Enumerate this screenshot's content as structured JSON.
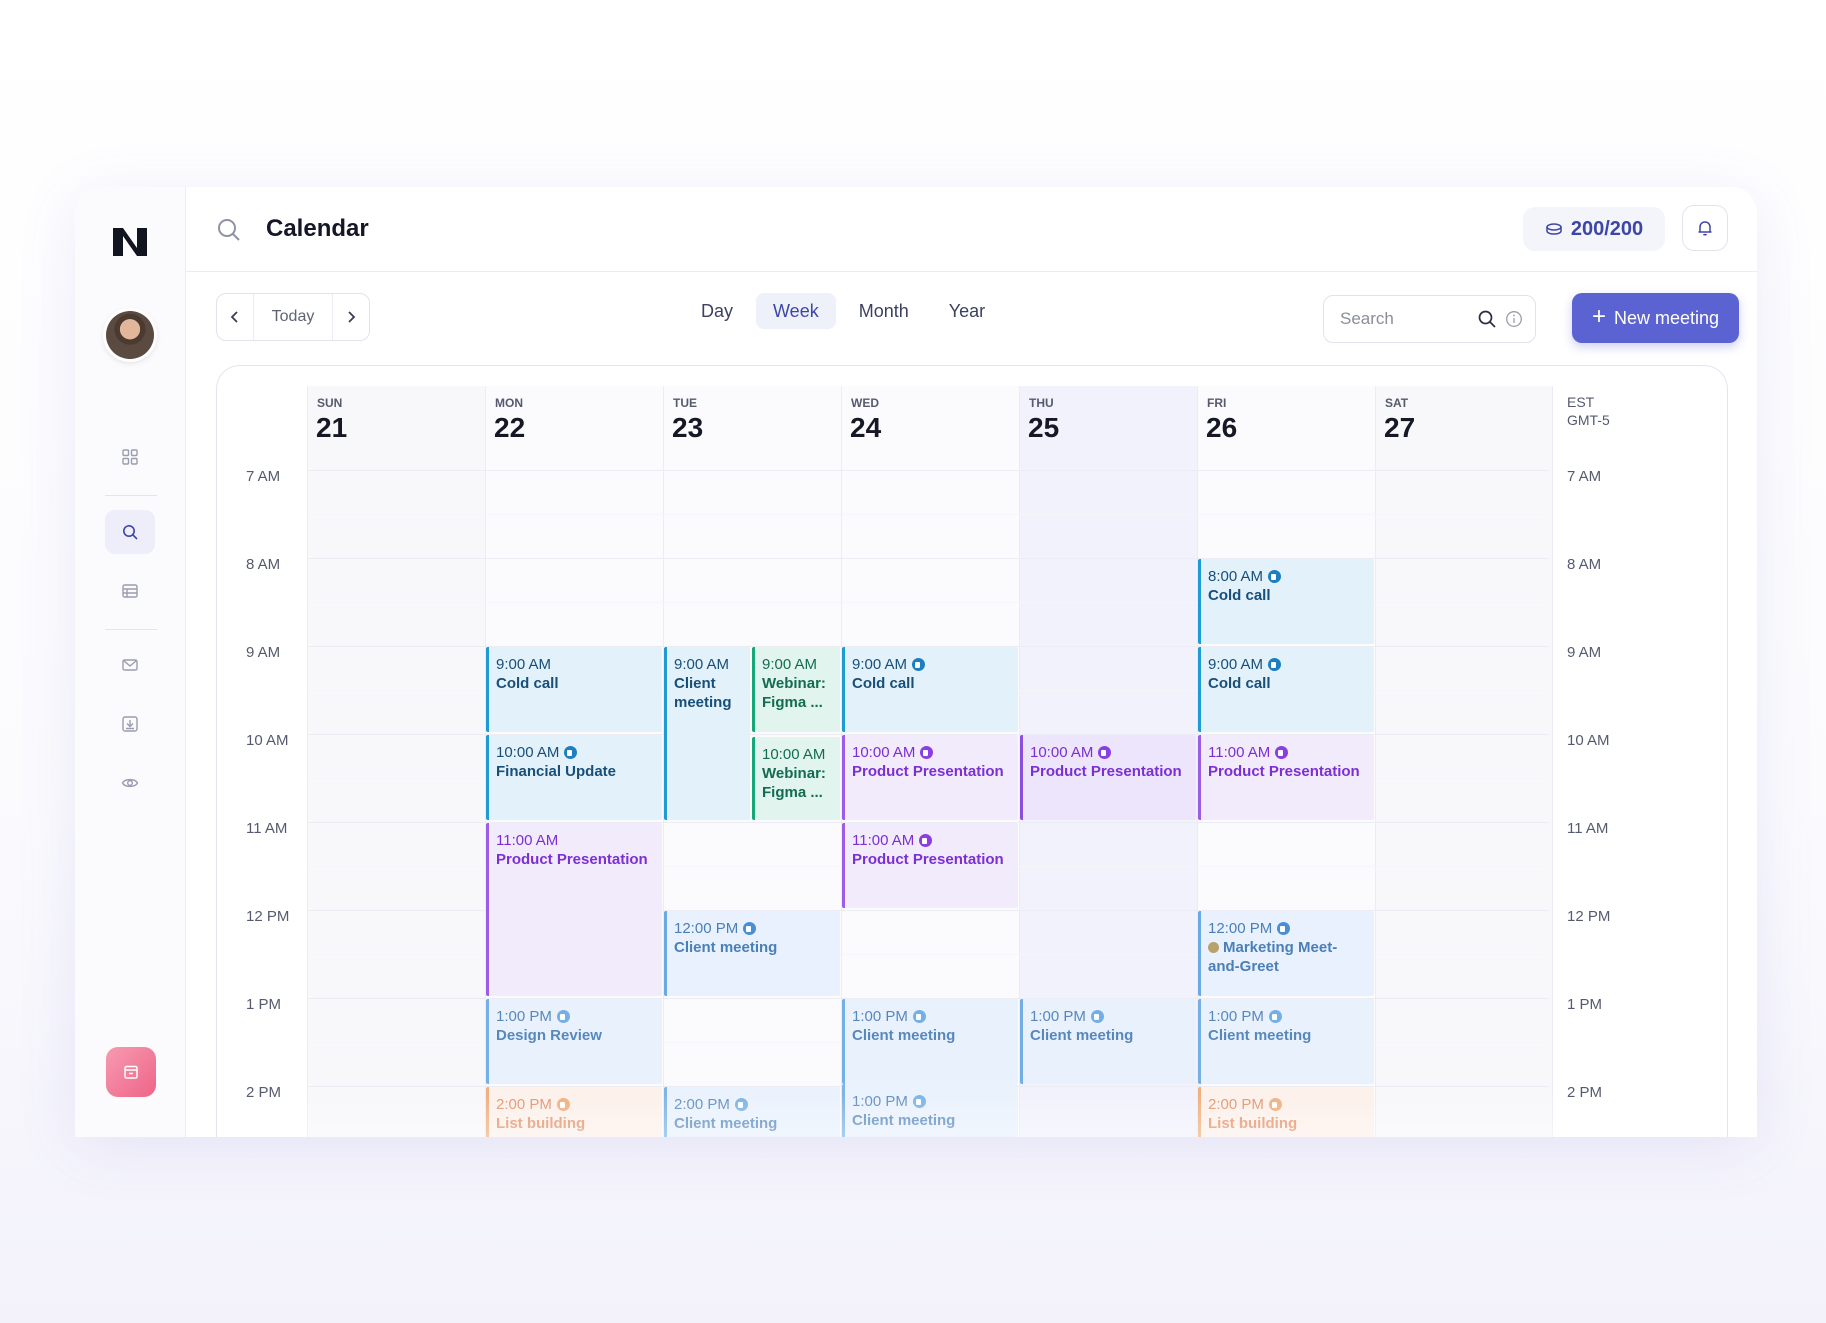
{
  "app": {
    "title": "Calendar"
  },
  "sidebar": {
    "logo": "n-logo",
    "avatar": "user-avatar",
    "icons": [
      "grid-icon",
      "search-icon",
      "table-icon",
      "mail-icon",
      "download-icon",
      "eye-icon"
    ],
    "bottom_app": "calendar-app-icon"
  },
  "topbar": {
    "credits": "200/200",
    "credits_icon": "coins-icon",
    "bell_icon": "bell-icon"
  },
  "toolbar": {
    "today_label": "Today",
    "views": [
      "Day",
      "Week",
      "Month",
      "Year"
    ],
    "active_view": "Week",
    "search_placeholder": "Search",
    "new_meeting_label": "New meeting"
  },
  "calendar": {
    "timezone_line1": "EST",
    "timezone_line2": "GMT-5",
    "days": [
      {
        "dow": "SUN",
        "num": "21"
      },
      {
        "dow": "MON",
        "num": "22"
      },
      {
        "dow": "TUE",
        "num": "23"
      },
      {
        "dow": "WED",
        "num": "24"
      },
      {
        "dow": "THU",
        "num": "25"
      },
      {
        "dow": "FRI",
        "num": "26"
      },
      {
        "dow": "SAT",
        "num": "27"
      }
    ],
    "hours": [
      "7 AM",
      "8 AM",
      "9 AM",
      "10 AM",
      "11 AM",
      "12 PM",
      "1 PM",
      "2 PM"
    ],
    "events": [
      {
        "time": "8:00 AM",
        "name": "Cold call"
      },
      {
        "time": "9:00 AM",
        "name": "Cold call"
      },
      {
        "time": "9:00 AM",
        "name": "Client meeting"
      },
      {
        "time": "9:00 AM",
        "name": "Webinar: Figma ..."
      },
      {
        "time": "9:00 AM",
        "name": "Cold call"
      },
      {
        "time": "9:00 AM",
        "name": "Cold call"
      },
      {
        "time": "10:00 AM",
        "name": "Financial Update"
      },
      {
        "time": "10:00 AM",
        "name": "Webinar: Figma ..."
      },
      {
        "time": "10:00 AM",
        "name": "Product Presentation"
      },
      {
        "time": "10:00 AM",
        "name": "Product Presentation"
      },
      {
        "time": "11:00 AM",
        "name": "Product Presentation"
      },
      {
        "time": "11:00 AM",
        "name": "Product Presentation"
      },
      {
        "time": "11:00 AM",
        "name": "Product Presentation"
      },
      {
        "time": "12:00 PM",
        "name": "Client meeting"
      },
      {
        "time": "12:00 PM",
        "name": "Marketing Meet-and-Greet"
      },
      {
        "time": "1:00 PM",
        "name": "Design Review"
      },
      {
        "time": "1:00 PM",
        "name": "Client meeting"
      },
      {
        "time": "1:00 PM",
        "name": "Client meeting"
      },
      {
        "time": "1:00 PM",
        "name": "Client meeting"
      },
      {
        "time": "2:00 PM",
        "name": "List building"
      },
      {
        "time": "2:00 PM",
        "name": "Client meeting"
      },
      {
        "time": "1:00 PM",
        "name": "Client meeting"
      },
      {
        "time": "2:00 PM",
        "name": "List building"
      }
    ]
  },
  "colors": {
    "accent": "#5b63d3",
    "cold_call": "#1e9bd4",
    "webinar": "#17a87a",
    "presentation": "#9b5de5",
    "client": "#69a9e4",
    "list_building": "#f0a36c"
  }
}
